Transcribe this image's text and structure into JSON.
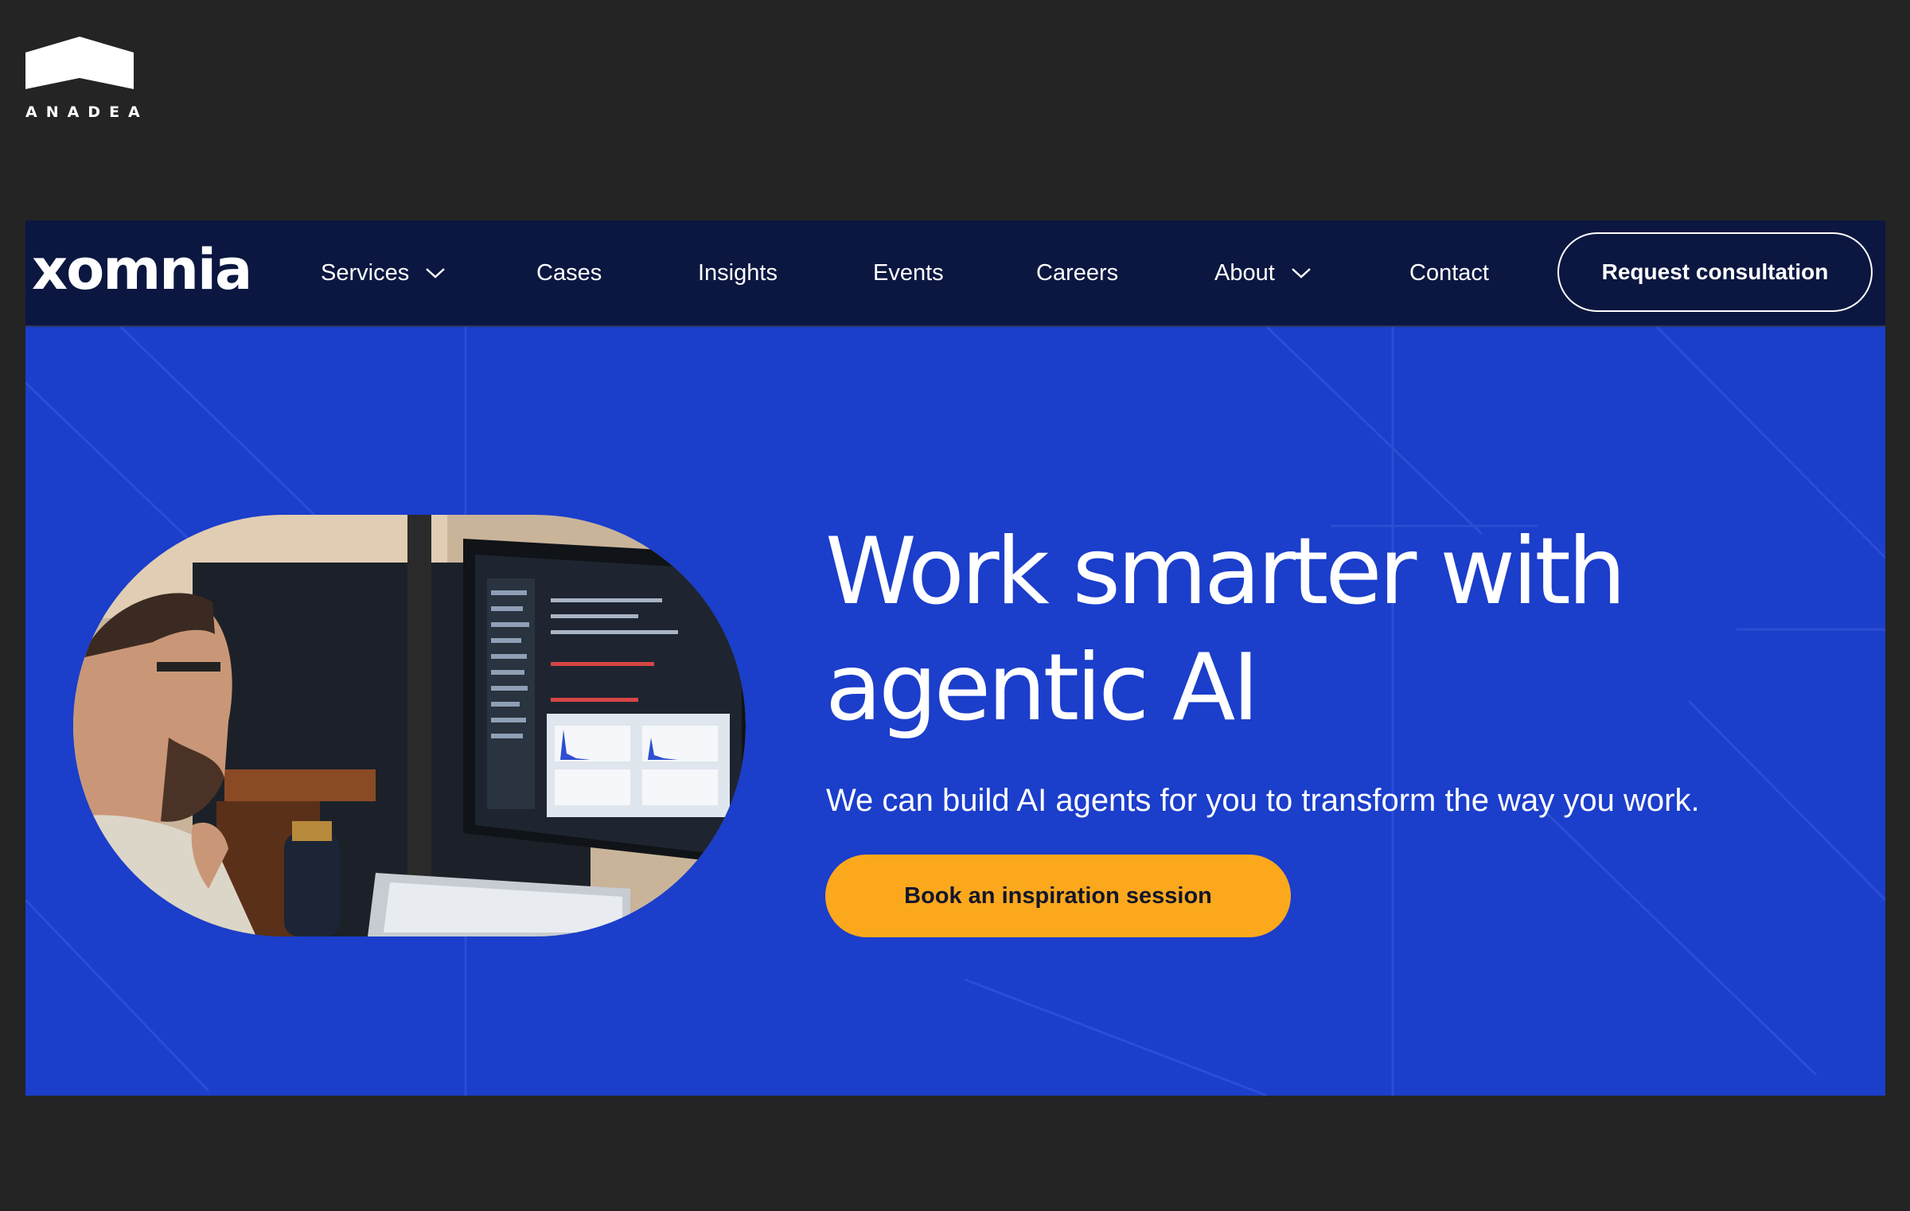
{
  "brand": {
    "wordmark": "ANADEA"
  },
  "site": {
    "logo": "xomnia",
    "nav": [
      {
        "label": "Services",
        "has_dropdown": true
      },
      {
        "label": "Cases",
        "has_dropdown": false
      },
      {
        "label": "Insights",
        "has_dropdown": false
      },
      {
        "label": "Events",
        "has_dropdown": false
      },
      {
        "label": "Careers",
        "has_dropdown": false
      },
      {
        "label": "About",
        "has_dropdown": true
      },
      {
        "label": "Contact",
        "has_dropdown": false
      }
    ],
    "cta": "Request consultation"
  },
  "hero": {
    "headline_line1": "Work smarter with",
    "headline_line2": "agentic AI",
    "subline": "We can build AI agents for you to transform the way you work.",
    "button": "Book an inspiration session"
  },
  "colors": {
    "page_bg": "#242424",
    "nav_bg": "#0b1740",
    "hero_bg": "#1b3ecb",
    "accent": "#fba81d"
  }
}
